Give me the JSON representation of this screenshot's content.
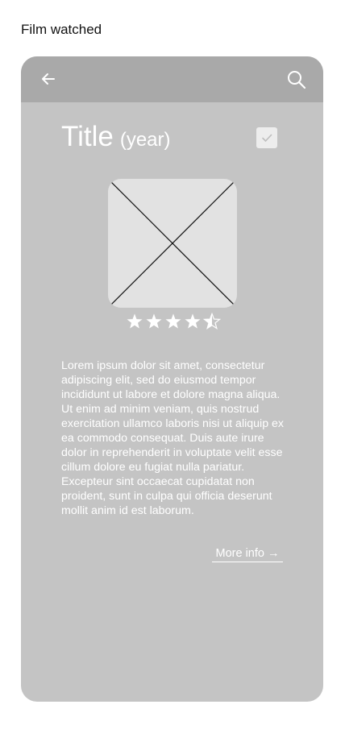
{
  "screen_caption": "Film watched",
  "header": {
    "back_icon": "arrow-left-icon",
    "search_icon": "search-icon"
  },
  "film": {
    "title": "Title",
    "year": "(year)",
    "watched": true,
    "poster_icon": "image-placeholder-icon",
    "rating": 4.5,
    "rating_max": 5,
    "description": "Lorem ipsum dolor sit amet, consectetur adipiscing elit, sed do eiusmod tempor incididunt ut labore et dolore magna aliqua. Ut enim ad minim veniam, quis nostrud exercitation ullamco laboris nisi ut aliquip ex ea commodo consequat. Duis aute irure dolor in reprehenderit in voluptate velit esse cillum dolore eu fugiat nulla pariatur. Excepteur sint occaecat cupidatat non proident, sunt in culpa qui officia deserunt mollit anim id est laborum.",
    "more_info_label": "More info",
    "more_info_arrow": "→"
  },
  "colors": {
    "card_background": "#c4c4c4",
    "app_bar": "#a9a9a9",
    "poster_placeholder": "#e2e2e2",
    "foreground": "#ffffff"
  }
}
